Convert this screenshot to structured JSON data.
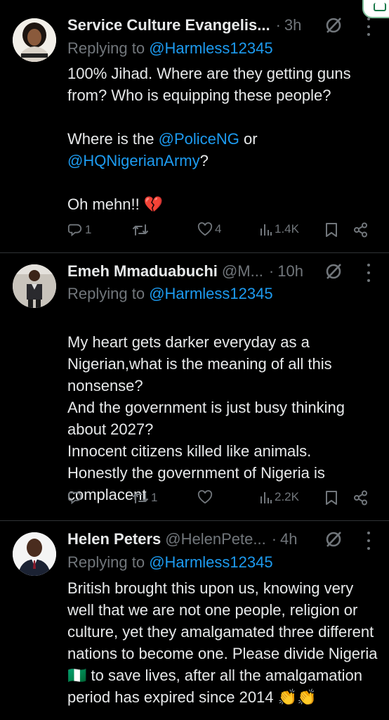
{
  "tweets": [
    {
      "name": "Service Culture Evangelis...",
      "handle": "",
      "dot": "·",
      "time": "3h",
      "replying_prefix": "Replying to ",
      "replying_to": "@Harmless12345",
      "body": {
        "line1": "100% Jihad.  Where are they getting guns from? Who is equipping these people?",
        "p2_pre": "Where is the ",
        "p2_m1": "@PoliceNG",
        "p2_mid": " or",
        "p2_m2": "@HQNigerianArmy",
        "p2_post": "?",
        "p3": "Oh mehn!! ",
        "p3_emoji": "💔"
      },
      "actions": {
        "replies": "1",
        "retweets": "",
        "likes": "4",
        "views": "1.4K"
      }
    },
    {
      "name": "Emeh Mmaduabuchi",
      "handle": "@M...",
      "dot": "·",
      "time": "10h",
      "replying_prefix": "Replying to ",
      "replying_to": "@Harmless12345",
      "body": {
        "text": "My heart gets darker everyday as a Nigerian,what is the meaning of all this nonsense?\nAnd the government is just busy thinking about 2027?\nInnocent citizens killed like animals.\nHonestly the government of Nigeria is complacent"
      },
      "actions": {
        "replies": "",
        "retweets": "1",
        "likes": "",
        "views": "2.2K"
      }
    },
    {
      "name": "Helen Peters",
      "handle": "@HelenPete...",
      "dot": "·",
      "time": "4h",
      "replying_prefix": "Replying to ",
      "replying_to": "@Harmless12345",
      "body": {
        "pre": "British brought this upon us, knowing very well that we are not one people, religion or culture, yet they amalgamated three different nations to become one. Please divide Nigeria ",
        "flag": "🇳🇬",
        "post": " to save lives, after all the amalgamation period has expired since 2014 ",
        "clap": "👏👏"
      }
    }
  ],
  "icons": {
    "grok": "grok-slash-circle-icon",
    "more": "more-vertical-icon",
    "reply": "reply-bubble-icon",
    "retweet": "retweet-icon",
    "like": "heart-icon",
    "views": "views-bar-chart-icon",
    "bookmark": "bookmark-icon",
    "share": "share-icon"
  },
  "colors": {
    "background": "#000000",
    "text": "#e7e9ea",
    "muted": "#71767b",
    "link": "#1d9bf0",
    "divider": "#2f3336"
  }
}
